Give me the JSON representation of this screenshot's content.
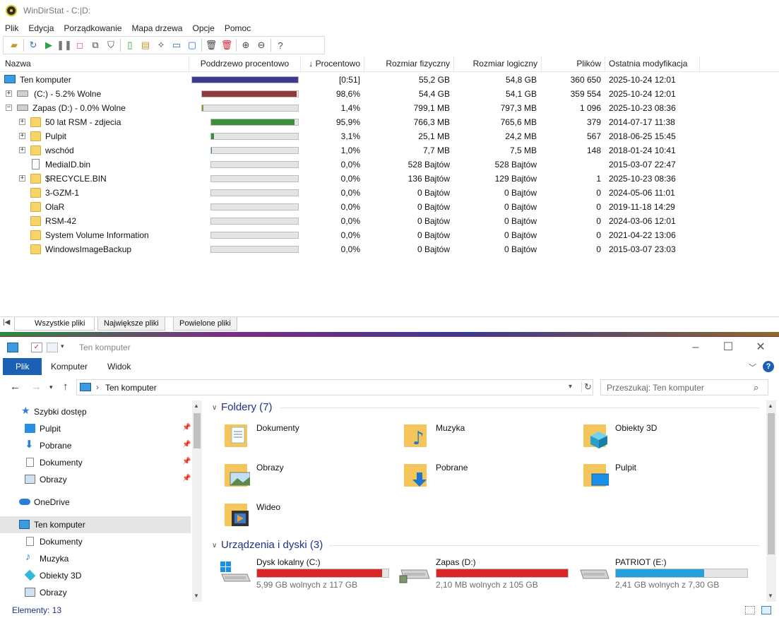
{
  "wds": {
    "title": "WinDirStat - C:|D:",
    "menu": [
      "Plik",
      "Edycja",
      "Porządkowanie",
      "Mapa drzewa",
      "Opcje",
      "Pomoc"
    ],
    "columns": [
      "Nazwa",
      "Poddrzewo procentowo",
      "↓ Procentowo",
      "Rozmiar fizyczny",
      "Rozmiar logiczny",
      "Plików",
      "Ostatnia modyfikacja"
    ],
    "rows": [
      {
        "name": "Ten komputer",
        "pct": "[0:51]",
        "phys": "55,2 GB",
        "log": "54,8 GB",
        "files": "360 650",
        "date": "2025-10-24  12:01",
        "bar": 1.0,
        "bar_color": "#3b3b8f"
      },
      {
        "name": "(C:) - 5.2% Wolne",
        "pct": "98,6%",
        "phys": "54,4 GB",
        "log": "54,1 GB",
        "files": "359 554",
        "date": "2025-10-24  12:01",
        "bar": 0.986,
        "bar_color": "#8f3b3b"
      },
      {
        "name": "Zapas (D:) - 0.0% Wolne",
        "pct": "1,4%",
        "phys": "799,1 MB",
        "log": "797,3 MB",
        "files": "1 096",
        "date": "2025-10-23  08:36",
        "bar": 0.014,
        "bar_color": "#8f8f3b"
      },
      {
        "name": "50 lat RSM - zdjecia",
        "pct": "95,9%",
        "phys": "766,3 MB",
        "log": "765,6 MB",
        "files": "379",
        "date": "2014-07-17  11:38",
        "bar": 0.959,
        "bar_color": "#3b8f3b"
      },
      {
        "name": "Pulpit",
        "pct": "3,1%",
        "phys": "25,1 MB",
        "log": "24,2 MB",
        "files": "567",
        "date": "2018-06-25  15:45",
        "bar": 0.031,
        "bar_color": "#3b8f3b"
      },
      {
        "name": "wschód",
        "pct": "1,0%",
        "phys": "7,7 MB",
        "log": "7,5 MB",
        "files": "148",
        "date": "2018-01-24  10:41",
        "bar": 0.01,
        "bar_color": "#3b8f3b"
      },
      {
        "name": "MediaID.bin",
        "pct": "0,0%",
        "phys": "528 Bajtów",
        "log": "528 Bajtów",
        "files": "",
        "date": "2015-03-07  22:47",
        "bar": 0,
        "bar_color": "#3b8f3b"
      },
      {
        "name": "$RECYCLE.BIN",
        "pct": "0,0%",
        "phys": "136 Bajtów",
        "log": "129 Bajtów",
        "files": "1",
        "date": "2025-10-23  08:36",
        "bar": 0,
        "bar_color": "#3b8f3b"
      },
      {
        "name": "3-GZM-1",
        "pct": "0,0%",
        "phys": "0 Bajtów",
        "log": "0 Bajtów",
        "files": "0",
        "date": "2024-05-06  11:01",
        "bar": 0,
        "bar_color": "#3b8f3b"
      },
      {
        "name": "OlaR",
        "pct": "0,0%",
        "phys": "0 Bajtów",
        "log": "0 Bajtów",
        "files": "0",
        "date": "2019-11-18  14:29",
        "bar": 0,
        "bar_color": "#3b8f3b"
      },
      {
        "name": "RSM-42",
        "pct": "0,0%",
        "phys": "0 Bajtów",
        "log": "0 Bajtów",
        "files": "0",
        "date": "2024-03-06  12:01",
        "bar": 0,
        "bar_color": "#3b8f3b"
      },
      {
        "name": "System Volume Information",
        "pct": "0,0%",
        "phys": "0 Bajtów",
        "log": "0 Bajtów",
        "files": "0",
        "date": "2021-04-22  13:06",
        "bar": 0,
        "bar_color": "#3b8f3b"
      },
      {
        "name": "WindowsImageBackup",
        "pct": "0,0%",
        "phys": "0 Bajtów",
        "log": "0 Bajtów",
        "files": "0",
        "date": "2015-03-07  23:03",
        "bar": 0,
        "bar_color": "#3b8f3b"
      }
    ],
    "tabs": [
      "Wszystkie pliki",
      "Największe pliki",
      "Powielone pliki"
    ]
  },
  "exp": {
    "title": "Ten komputer",
    "ribbon": [
      "Plik",
      "Komputer",
      "Widok"
    ],
    "address": "Ten komputer",
    "search_placeholder": "Przeszukaj: Ten komputer",
    "nav": {
      "quick_access": "Szybki dostęp",
      "qa_items": [
        "Pulpit",
        "Pobrane",
        "Dokumenty",
        "Obrazy"
      ],
      "onedrive": "OneDrive",
      "this_pc": "Ten komputer",
      "pc_items": [
        "Dokumenty",
        "Muzyka",
        "Obiekty 3D",
        "Obrazy"
      ]
    },
    "folders_header": "Foldery (7)",
    "folders": [
      "Dokumenty",
      "Muzyka",
      "Obiekty 3D",
      "Obrazy",
      "Pobrane",
      "Pulpit",
      "Wideo"
    ],
    "drives_header": "Urządzenia i dyski (3)",
    "drives": [
      {
        "name": "Dysk lokalny (C:)",
        "detail": "5,99 GB wolnych z 117 GB",
        "used": 0.949,
        "color": "#da2626"
      },
      {
        "name": "Zapas (D:)",
        "detail": "2,10 MB wolnych z 105 GB",
        "used": 1.0,
        "color": "#da2626"
      },
      {
        "name": "PATRIOT (E:)",
        "detail": "2,41 GB wolnych z 7,30 GB",
        "used": 0.67,
        "color": "#26a0da"
      }
    ],
    "status": "Elementy: 13"
  }
}
